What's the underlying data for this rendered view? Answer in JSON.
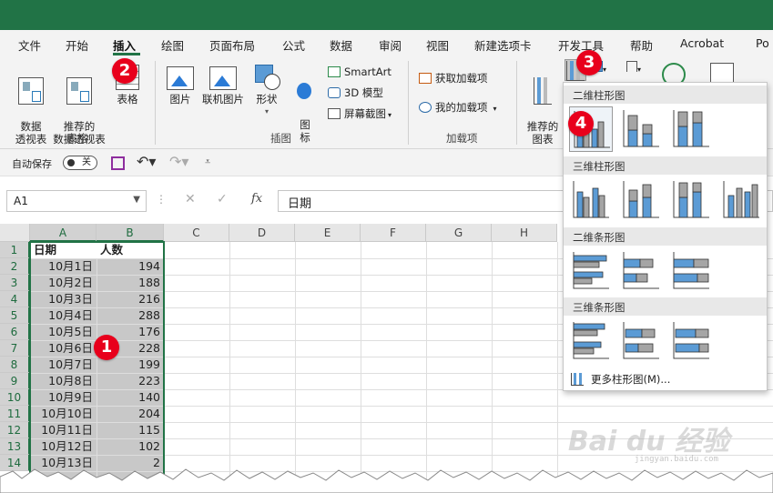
{
  "ribbon_tabs": [
    "文件",
    "开始",
    "插入",
    "绘图",
    "页面布局",
    "公式",
    "数据",
    "审阅",
    "视图",
    "新建选项卡",
    "开发工具",
    "帮助",
    "Acrobat",
    "Po"
  ],
  "active_tab": "插入",
  "ribbon": {
    "pivot_table": "数据\n透视表",
    "recommended_pivot": "推荐的\n数据透视表",
    "table": "表格",
    "group_tables": "表格",
    "picture": "图片",
    "online_picture": "联机图片",
    "shapes": "形状",
    "icons": "图\n标",
    "smartart": "SmartArt",
    "model_3d": "3D 模型",
    "screenshot": "屏幕截图",
    "group_illustrations": "插图",
    "get_addins": "获取加载项",
    "my_addins": "我的加载项",
    "group_addins": "加载项",
    "recommended_charts": "推荐的\n图表"
  },
  "qat": {
    "autosave_label": "自动保存",
    "autosave_state": "关"
  },
  "formula_bar": {
    "name_box": "A1",
    "formula": "日期"
  },
  "columns": [
    "A",
    "B",
    "C",
    "D",
    "E",
    "F",
    "G",
    "H"
  ],
  "rows": [
    "1",
    "2",
    "3",
    "4",
    "5",
    "6",
    "7",
    "8",
    "9",
    "10",
    "11",
    "12",
    "13",
    "14"
  ],
  "table": {
    "headers": [
      "日期",
      "人数"
    ],
    "data": [
      [
        "10月1日",
        "194"
      ],
      [
        "10月2日",
        "188"
      ],
      [
        "10月3日",
        "216"
      ],
      [
        "10月4日",
        "288"
      ],
      [
        "10月5日",
        "176"
      ],
      [
        "10月6日",
        "228"
      ],
      [
        "10月7日",
        "199"
      ],
      [
        "10月8日",
        "223"
      ],
      [
        "10月9日",
        "140"
      ],
      [
        "10月10日",
        "204"
      ],
      [
        "10月11日",
        "115"
      ],
      [
        "10月12日",
        "102"
      ],
      [
        "10月13日",
        "2"
      ]
    ]
  },
  "dropdown": {
    "sections": [
      "二维柱形图",
      "三维柱形图",
      "二维条形图",
      "三维条形图"
    ],
    "more_charts": "更多柱形图(M)..."
  },
  "step_badges": [
    "1",
    "2",
    "3",
    "4"
  ],
  "watermark": {
    "logo": "Bai du 经验",
    "url": "jingyan.baidu.com"
  },
  "colors": {
    "title_bar": "#217346",
    "badge": "#e8001c",
    "chart_blue": "#5b9bd5",
    "chart_gray": "#a5a5a5",
    "selection_fill": "#c8c8c8"
  }
}
